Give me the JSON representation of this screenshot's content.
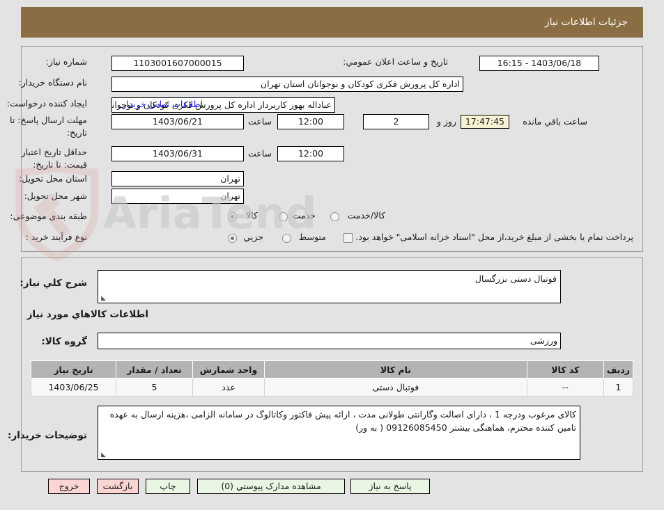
{
  "header": {
    "title": "جزئیات اطلاعات نیاز"
  },
  "watermark": {
    "text": "AriaTender.net",
    "logo": "shield-gavel-icon"
  },
  "form": {
    "need_number": {
      "label": "شماره نیاز:",
      "value": "1103001607000015"
    },
    "public_announce": {
      "label": "تاریخ و ساعت اعلان عمومي:",
      "value": "1403/06/18 - 16:15"
    },
    "buyer_org": {
      "label": "نام دستگاه خریدار:",
      "value": "اداره کل پرورش فکری کودکان و نوجوانان استان تهران"
    },
    "requester": {
      "label": "ایجاد کننده درخواست:",
      "value": "عباداله بهور کاربرداز اداره کل پرورش فکری کودکان و نوجوانان استان تهران",
      "contact_link": "اطلاعات تماس خریدار"
    },
    "response_deadline": {
      "label": "مهلت ارسال پاسخ: تا تاریخ:",
      "date": "1403/06/21",
      "time_label": "ساعت",
      "time": "12:00",
      "days": "2",
      "days_label": "روز و",
      "countdown": "17:47:45",
      "countdown_label": "ساعت باقي مانده"
    },
    "price_validity": {
      "label": "حداقل تاریخ اعتبار قیمت: تا تاریخ:",
      "date": "1403/06/31",
      "time_label": "ساعت",
      "time": "12:00"
    },
    "delivery_province": {
      "label": "استان محل تحویل:",
      "value": "تهران"
    },
    "delivery_city": {
      "label": "شهر محل تحویل:",
      "value": "تهران"
    },
    "category": {
      "label": "طبقه بندی موضوعی:",
      "options": [
        {
          "label": "کالا",
          "selected": true
        },
        {
          "label": "خدمت",
          "selected": false
        },
        {
          "label": "کالا/خدمت",
          "selected": false
        }
      ]
    },
    "purchase_type": {
      "label": "نوع فرآیند خرید :",
      "options": [
        {
          "label": "جزیي",
          "selected": true
        },
        {
          "label": "متوسط",
          "selected": false
        }
      ],
      "checkbox_note": "پرداخت تمام یا بخشی از مبلغ خرید،از محل \"اسناد خزانه اسلامی\" خواهد بود.",
      "checkbox_checked": false
    }
  },
  "need_summary": {
    "label": "شرح کلي نیاز:",
    "value": "فوتبال دستی بزرگسال"
  },
  "items_section": {
    "title": "اطلاعات کالاهاي مورد نیاز",
    "group_label": "گروه کالا:",
    "group_value": "ورزشی",
    "columns": [
      "ردیف",
      "کد کالا",
      "نام کالا",
      "واحد شمارش",
      "تعداد / مقدار",
      "تاریخ نیاز"
    ],
    "rows": [
      {
        "row_no": "1",
        "item_code": "--",
        "item_name": "فوتبال دستی",
        "unit": "عدد",
        "quantity": "5",
        "need_date": "1403/06/25"
      }
    ]
  },
  "buyer_notes": {
    "label": "توضیحات خریدار:",
    "value": "کالای مرغوب ودرجه 1 ، دارای اصالت وگارانتی طولانی مدت ، ارائه پیش فاکتور وکاتالوگ در سامانه الزامی ،هزینه ارسال به عهده تامین کننده محترم، هماهنگی بیشتر 09126085450 ( به ور)"
  },
  "buttons": [
    {
      "name": "respond",
      "label": "پاسخ به نیاز",
      "style": "green"
    },
    {
      "name": "view-attachments",
      "label": "مشاهده مدارک پیوستي (0)",
      "style": "green"
    },
    {
      "name": "print",
      "label": "چاپ",
      "style": "green"
    },
    {
      "name": "back",
      "label": "بازگشت",
      "style": "red"
    },
    {
      "name": "exit",
      "label": "خروج",
      "style": "red"
    }
  ],
  "colors": {
    "header_bg": "#8a6d42",
    "page_bg": "#e3e3e3",
    "table_header_bg": "#b4b4b4",
    "link": "#2020e0",
    "timer_bg": "#f7f2d4",
    "btn_green": "#e9f6e4",
    "btn_red": "#fbd5d3"
  }
}
